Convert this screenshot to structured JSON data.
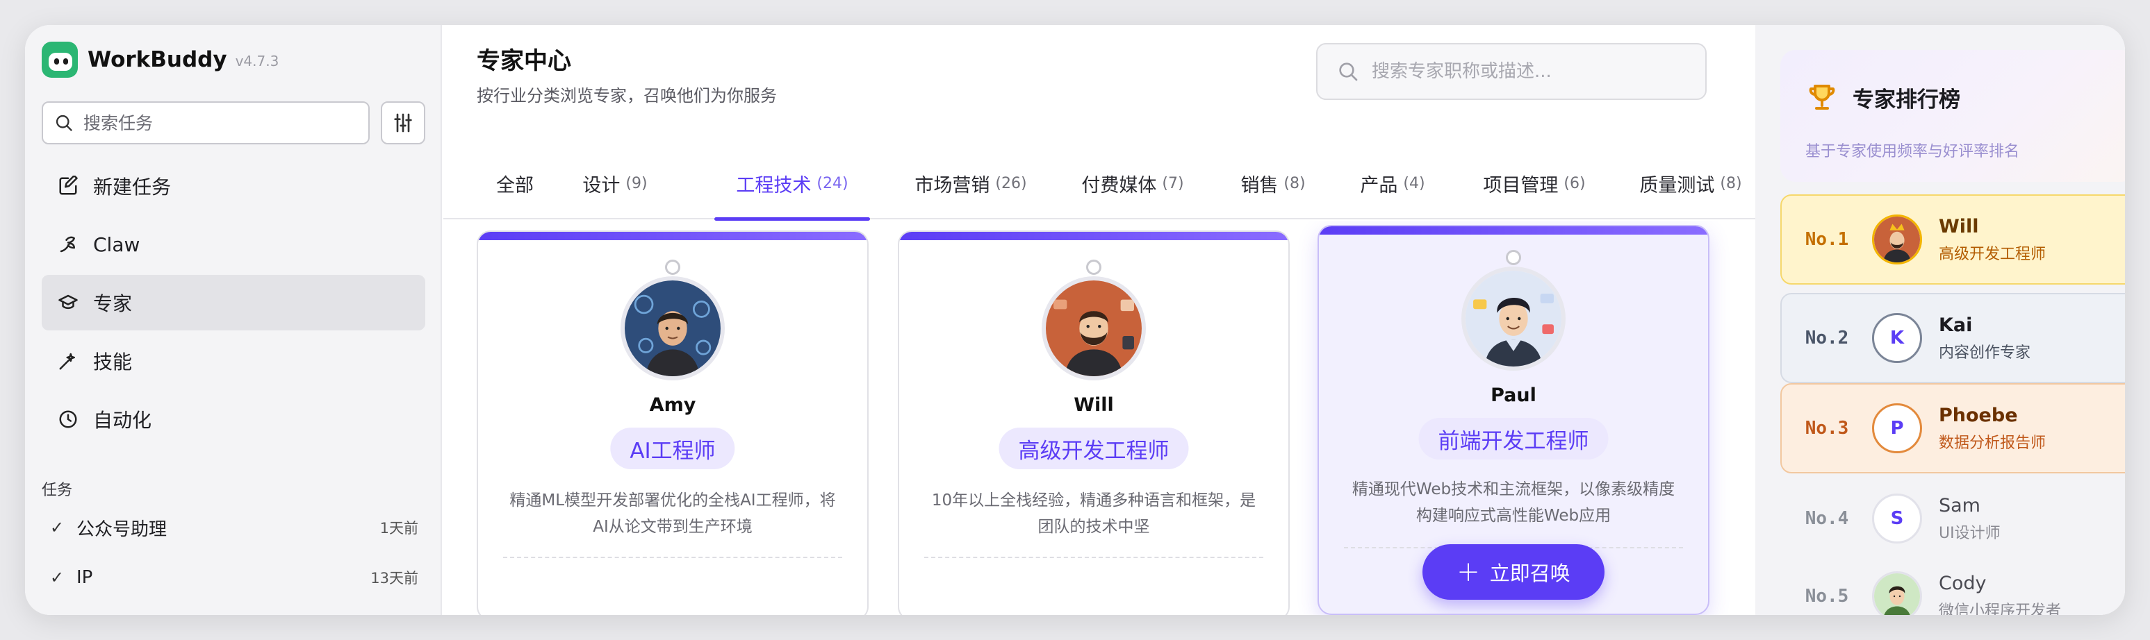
{
  "app": {
    "name": "WorkBuddy",
    "version": "v4.7.3"
  },
  "sidebar": {
    "search_placeholder": "搜索任务",
    "nav": [
      {
        "label": "新建任务",
        "icon": "edit-square-icon"
      },
      {
        "label": "Claw",
        "icon": "claw-icon"
      },
      {
        "label": "专家",
        "icon": "graduation-cap-icon",
        "active": true
      },
      {
        "label": "技能",
        "icon": "magic-wand-icon"
      },
      {
        "label": "自动化",
        "icon": "clock-icon"
      }
    ],
    "section_label": "任务",
    "tasks": [
      {
        "label": "公众号助理",
        "time": "1天前"
      },
      {
        "label": "IP",
        "time": "13天前"
      }
    ]
  },
  "main": {
    "title": "专家中心",
    "subtitle": "按行业分类浏览专家，召唤他们为你服务",
    "search_placeholder": "搜索专家职称或描述...",
    "tabs": [
      {
        "label": "全部",
        "count": ""
      },
      {
        "label": "设计",
        "count": "(9)"
      },
      {
        "label": "工程技术",
        "count": "(24)",
        "active": true
      },
      {
        "label": "市场营销",
        "count": "(26)"
      },
      {
        "label": "付费媒体",
        "count": "(7)"
      },
      {
        "label": "销售",
        "count": "(8)"
      },
      {
        "label": "产品",
        "count": "(4)"
      },
      {
        "label": "项目管理",
        "count": "(6)"
      },
      {
        "label": "质量测试",
        "count": "(8)"
      }
    ],
    "cards": [
      {
        "name": "Amy",
        "role": "AI工程师",
        "desc": "精通ML模型开发部署优化的全栈AI工程师，将AI从论文带到生产环境"
      },
      {
        "name": "Will",
        "role": "高级开发工程师",
        "desc": "10年以上全栈经验，精通多种语言和框架，是团队的技术中坚"
      },
      {
        "name": "Paul",
        "role": "前端开发工程师",
        "desc": "精通现代Web技术和主流框架，以像素级精度构建响应式高性能Web应用",
        "hover": true
      }
    ],
    "summon_label": "立即召唤"
  },
  "ranking": {
    "title": "专家排行榜",
    "subtitle": "基于专家使用频率与好评率排名",
    "items": [
      {
        "rank": "No.1",
        "name": "Will",
        "role": "高级开发工程师",
        "tier": "gold"
      },
      {
        "rank": "No.2",
        "name": "Kai",
        "role": "内容创作专家",
        "tier": "silver",
        "initial": "K"
      },
      {
        "rank": "No.3",
        "name": "Phoebe",
        "role": "数据分析报告师",
        "tier": "bronze",
        "initial": "P"
      },
      {
        "rank": "No.4",
        "name": "Sam",
        "role": "UI设计师",
        "tier": "plain",
        "initial": "S"
      },
      {
        "rank": "No.5",
        "name": "Cody",
        "role": "微信小程序开发者",
        "tier": "plain"
      }
    ]
  },
  "colors": {
    "accent": "#5b3df5",
    "brand": "#2bb673",
    "gold": "#c46f00",
    "bronze": "#c0581a"
  }
}
